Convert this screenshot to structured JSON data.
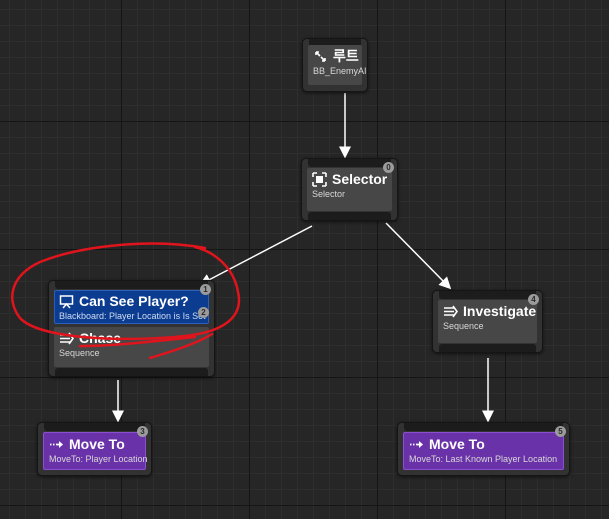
{
  "nodes": {
    "root": {
      "title": "루트",
      "subtitle": "BB_EnemyAI",
      "icon": "root-icon"
    },
    "selector": {
      "title": "Selector",
      "subtitle": "Selector",
      "index": "0",
      "icon": "selector-icon"
    },
    "chase": {
      "title": "Chase",
      "subtitle": "Sequence",
      "index": "1",
      "icon": "sequence-icon",
      "decorator": {
        "title": "Can See Player?",
        "subtitle": "Blackboard: Player Location is Is Set",
        "index": "2",
        "icon": "monitor-icon"
      }
    },
    "investigate": {
      "title": "Investigate",
      "subtitle": "Sequence",
      "index": "4",
      "icon": "sequence-icon"
    },
    "move_to_chase": {
      "title": "Move To",
      "subtitle": "MoveTo: Player Location",
      "index": "3",
      "icon": "move-to-icon"
    },
    "move_to_investigate": {
      "title": "Move To",
      "subtitle": "MoveTo: Last Known Player Location",
      "index": "5",
      "icon": "move-to-icon"
    }
  },
  "colors": {
    "canvas": "#262626",
    "node_body": "#474747",
    "decorator": "#0b3c8f",
    "task": "#6a32a8",
    "wire": "#ffffff",
    "annotation": "#e0141c"
  }
}
